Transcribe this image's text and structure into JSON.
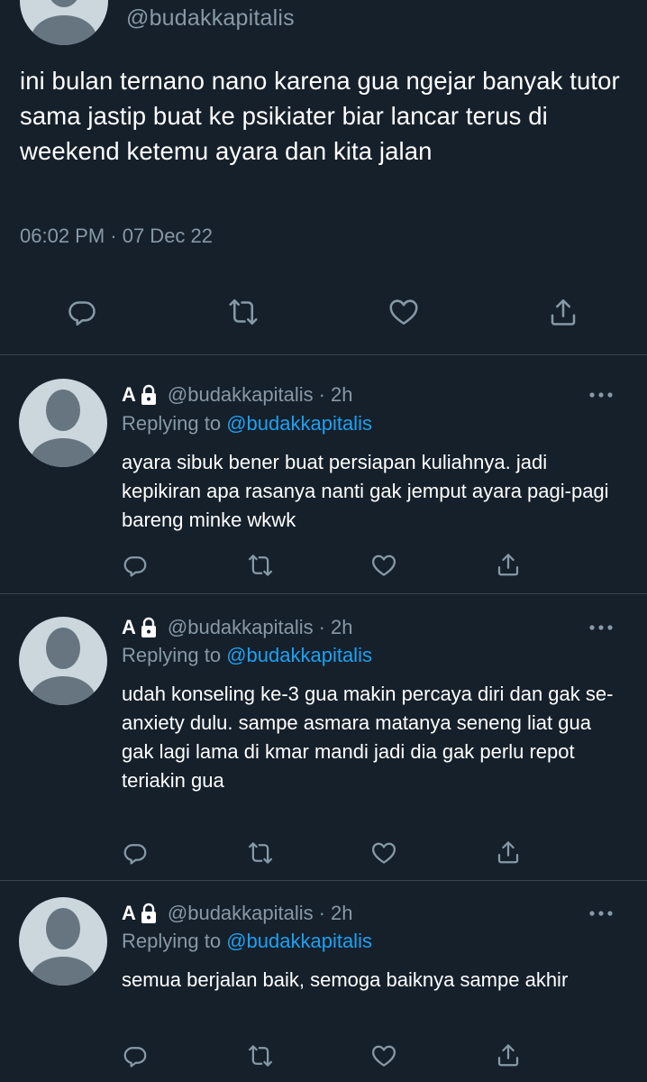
{
  "main_tweet": {
    "handle": "@budakkapitalis",
    "text": "ini bulan ternano nano karena gua ngejar banyak tutor sama jastip buat ke psikiater biar lancar terus di weekend ketemu ayara dan kita jalan",
    "timestamp": "06:02 PM · 07 Dec 22",
    "actions": [
      "reply-icon",
      "retweet-icon",
      "like-icon",
      "share-icon"
    ]
  },
  "replies": [
    {
      "name": "A",
      "handle": "@budakkapitalis",
      "separator": "·",
      "time": "2h",
      "replying_prefix": "Replying to",
      "replying_to": "@budakkapitalis",
      "text": "ayara sibuk bener buat persiapan kuliahnya. jadi kepikiran apa rasanya nanti gak jemput ayara pagi-pagi bareng minke wkwk"
    },
    {
      "name": "A",
      "handle": "@budakkapitalis",
      "separator": "·",
      "time": "2h",
      "replying_prefix": "Replying to",
      "replying_to": "@budakkapitalis",
      "text": "udah konseling ke-3 gua makin percaya diri dan gak se-anxiety dulu. sampe asmara matanya seneng liat gua gak lagi lama di kmar mandi jadi dia gak perlu repot teriakin gua"
    },
    {
      "name": "A",
      "handle": "@budakkapitalis",
      "separator": "·",
      "time": "2h",
      "replying_prefix": "Replying to",
      "replying_to": "@budakkapitalis",
      "text": "semua berjalan baik, semoga baiknya sampe akhir"
    }
  ],
  "colors": {
    "background": "#15202b",
    "text_primary": "#ffffff",
    "text_secondary": "#8899a6",
    "link": "#1da1f2",
    "divider": "#38444d",
    "avatar_bg": "#ccd6dd",
    "avatar_fg": "#66757f"
  }
}
